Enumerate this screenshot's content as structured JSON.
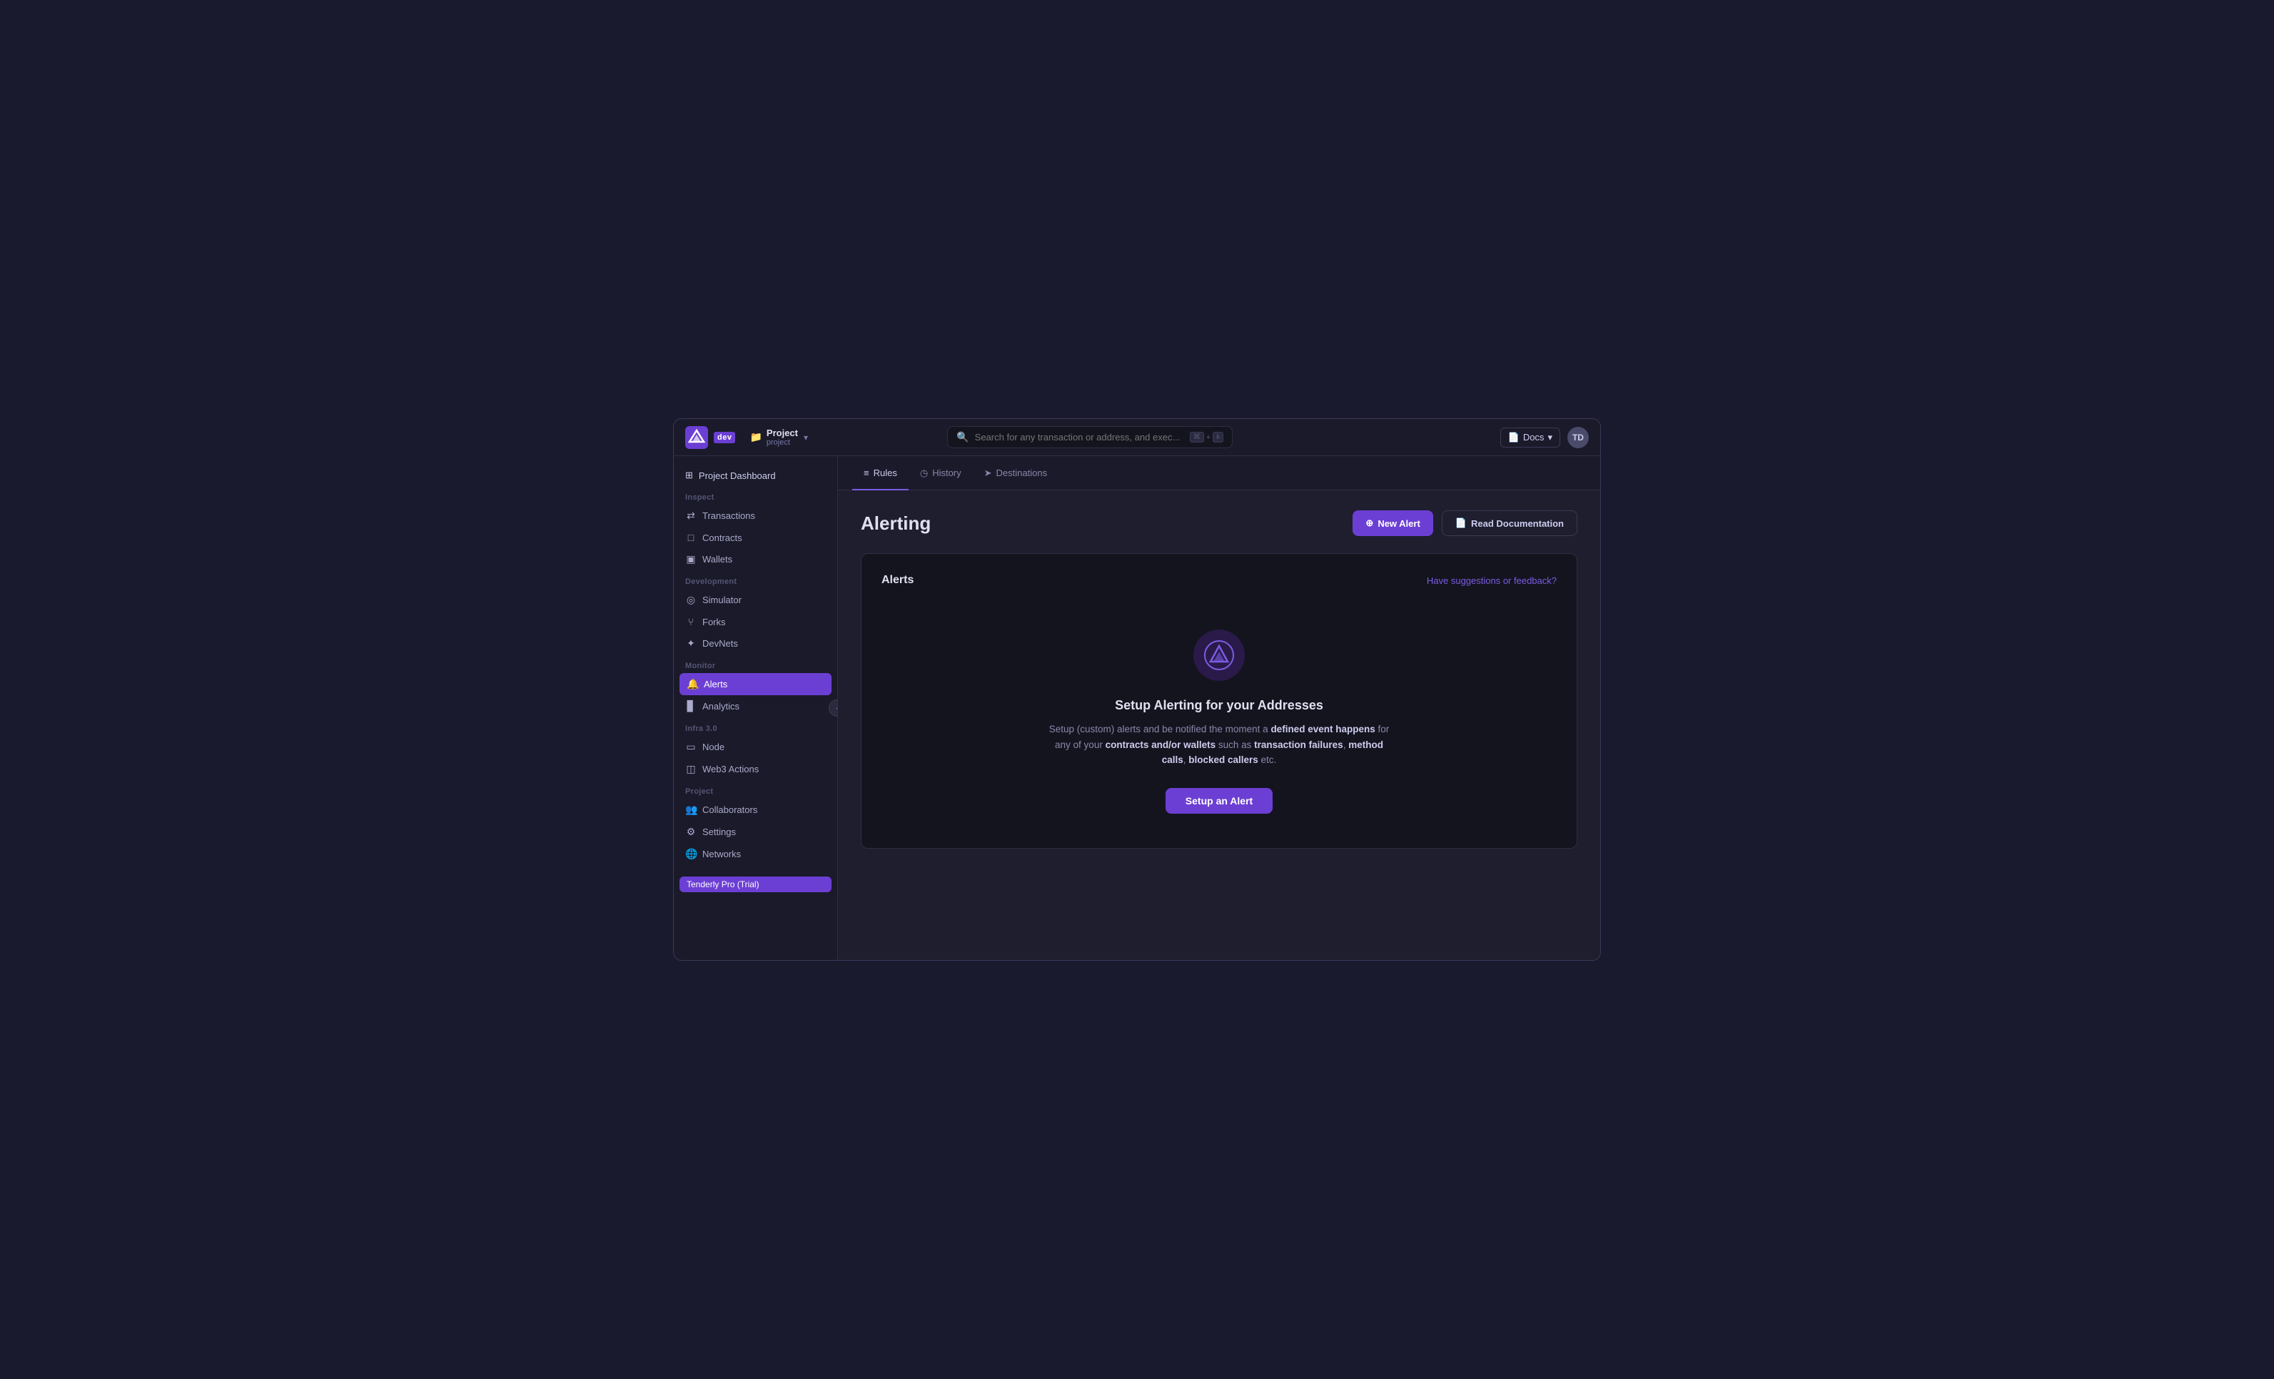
{
  "app": {
    "title": "Tenderly",
    "badge": "dev"
  },
  "project": {
    "name": "Project",
    "sub": "project",
    "folder_icon": "📁",
    "chevron": "▾"
  },
  "search": {
    "placeholder": "Search for any transaction or address, and exec...",
    "kbd1": "⌘",
    "kbd2": "k"
  },
  "topbar": {
    "docs_label": "Docs",
    "docs_chevron": "▾",
    "avatar": "TD"
  },
  "sidebar": {
    "project_dashboard_label": "Project Dashboard",
    "inspect_label": "Inspect",
    "items_inspect": [
      {
        "id": "transactions",
        "label": "Transactions",
        "icon": "⇄"
      },
      {
        "id": "contracts",
        "label": "Contracts",
        "icon": "□"
      },
      {
        "id": "wallets",
        "label": "Wallets",
        "icon": "▣"
      }
    ],
    "development_label": "Development",
    "items_development": [
      {
        "id": "simulator",
        "label": "Simulator",
        "icon": "◎"
      },
      {
        "id": "forks",
        "label": "Forks",
        "icon": "⑂"
      },
      {
        "id": "devnets",
        "label": "DevNets",
        "icon": "✦"
      }
    ],
    "monitor_label": "Monitor",
    "items_monitor": [
      {
        "id": "alerts",
        "label": "Alerts",
        "icon": "🔔",
        "active": true
      },
      {
        "id": "analytics",
        "label": "Analytics",
        "icon": "▊"
      }
    ],
    "infra_label": "Infra 3.0",
    "items_infra": [
      {
        "id": "node",
        "label": "Node",
        "icon": "▭"
      },
      {
        "id": "web3actions",
        "label": "Web3 Actions",
        "icon": "◫"
      }
    ],
    "project_label": "Project",
    "items_project": [
      {
        "id": "collaborators",
        "label": "Collaborators",
        "icon": "👥"
      },
      {
        "id": "settings",
        "label": "Settings",
        "icon": "⚙"
      },
      {
        "id": "networks",
        "label": "Networks",
        "icon": "🌐"
      }
    ],
    "bottom_item_label": "Tenderly Pro (Trial)",
    "collapse_icon": "‹"
  },
  "tabs": [
    {
      "id": "rules",
      "label": "Rules",
      "icon": "≡",
      "active": true
    },
    {
      "id": "history",
      "label": "History",
      "icon": "◷"
    },
    {
      "id": "destinations",
      "label": "Destinations",
      "icon": "➤"
    }
  ],
  "page": {
    "title": "Alerting",
    "new_alert_label": "New Alert",
    "new_alert_icon": "⊕",
    "read_docs_label": "Read Documentation",
    "read_docs_icon": "📄"
  },
  "alerts_card": {
    "title": "Alerts",
    "feedback_label": "Have suggestions or feedback?"
  },
  "empty_state": {
    "title": "Setup Alerting for your Addresses",
    "desc_parts": [
      "Setup (custom) alerts and be notified the moment a ",
      "defined event happens",
      " for any of your ",
      "contracts and/or wallets",
      " such as ",
      "transaction failures",
      ", ",
      "method calls",
      ", ",
      "blocked callers",
      " etc."
    ],
    "setup_button_label": "Setup an Alert"
  }
}
